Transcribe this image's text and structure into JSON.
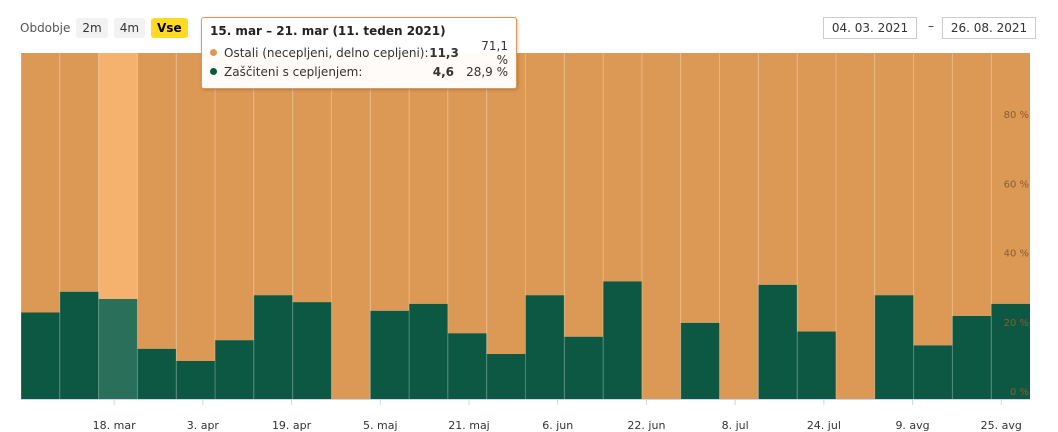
{
  "period": {
    "label": "Obdobje",
    "options": [
      "2m",
      "4m",
      "Vse"
    ],
    "selected": "Vse"
  },
  "date_range": {
    "from": "04. 03. 2021",
    "separator": "–",
    "to": "26. 08. 2021"
  },
  "tooltip": {
    "title": "15. mar – 21. mar (11. teden 2021)",
    "rows": [
      {
        "name": "Ostali (necepljeni, delno cepljeni):",
        "value": "11,3",
        "percent": "71,1 %",
        "color": "#dc9955"
      },
      {
        "name": "Zaščiteni s cepljenjem:",
        "value": "4,6",
        "percent": "28,9 %",
        "color": "#0d5842"
      }
    ]
  },
  "chart_data": {
    "type": "bar",
    "stacking": "percent",
    "colors": {
      "protected": "#0d5842",
      "others": "#dc9955",
      "highlight_protected": "#2a6f5a",
      "highlight_others": "#f5b26e"
    },
    "highlighted_index": 2,
    "series": [
      {
        "name": "Zaščiteni s cepljenjem:",
        "values": [
          25,
          31,
          28.9,
          14.5,
          11,
          17,
          30,
          28,
          0,
          25.5,
          27.5,
          19,
          13,
          30,
          18,
          34,
          0,
          22,
          0,
          33,
          19.5,
          0,
          30,
          15.5,
          24,
          27.5
        ]
      },
      {
        "name": "Ostali (necepljeni, delno cepljeni):",
        "values": [
          75,
          69,
          71.1,
          85.5,
          89,
          83,
          70,
          72,
          100,
          74.5,
          72.5,
          81,
          87,
          70,
          82,
          66,
          100,
          78,
          100,
          67,
          80.5,
          100,
          70,
          84.5,
          76,
          72.5
        ]
      }
    ],
    "x_tick_labels": [
      "18. mar",
      "3. apr",
      "19. apr",
      "5. maj",
      "21. maj",
      "6. jun",
      "22. jun",
      "8. jul",
      "24. jul",
      "9. avg",
      "25. avg"
    ],
    "y_ticks": [
      "0 %",
      "20 %",
      "40 %",
      "60 %",
      "80 %"
    ],
    "ylim": [
      0,
      100
    ]
  }
}
